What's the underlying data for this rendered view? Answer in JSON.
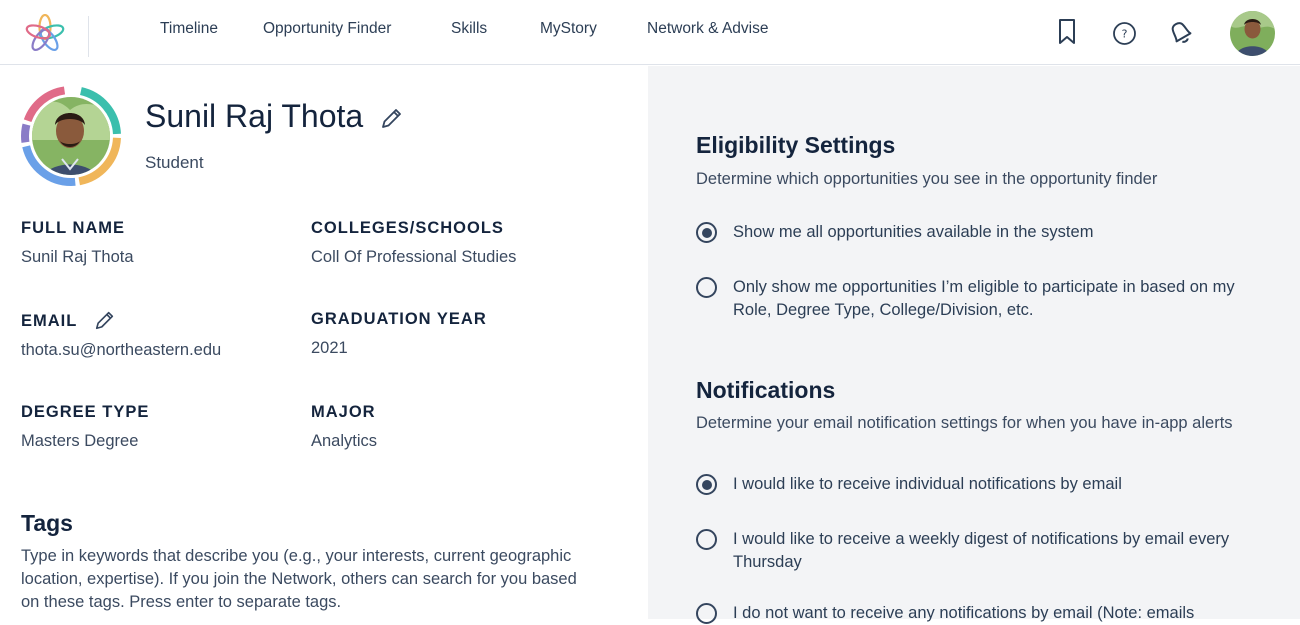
{
  "nav": {
    "links": [
      "Timeline",
      "Opportunity Finder",
      "Skills",
      "MyStory",
      "Network & Advise"
    ],
    "icons": [
      "bookmark-icon",
      "help-icon",
      "bell-icon"
    ]
  },
  "profile": {
    "name": "Sunil Raj Thota",
    "role": "Student",
    "fields": {
      "full_name": {
        "label": "FULL NAME",
        "value": "Sunil Raj Thota"
      },
      "colleges": {
        "label": "COLLEGES/SCHOOLS",
        "value": "Coll Of Professional Studies"
      },
      "email": {
        "label": "EMAIL",
        "value": "thota.su@northeastern.edu"
      },
      "graduation_year": {
        "label": "GRADUATION YEAR",
        "value": "2021"
      },
      "degree_type": {
        "label": "DEGREE TYPE",
        "value": "Masters Degree"
      },
      "major": {
        "label": "MAJOR",
        "value": "Analytics"
      }
    },
    "tags": {
      "title": "Tags",
      "description": "Type in keywords that describe you (e.g., your interests, current geographic location, expertise). If you join the Network, others can search for you based on these tags. Press enter to separate tags."
    }
  },
  "eligibility": {
    "title": "Eligibility Settings",
    "description": "Determine which opportunities you see in the opportunity finder",
    "options": [
      {
        "label": "Show me all opportunities available in the system",
        "checked": true
      },
      {
        "label": "Only show me opportunities I’m eligible to participate in based on my Role, Degree Type, College/Division, etc.",
        "checked": false
      }
    ]
  },
  "notifications": {
    "title": "Notifications",
    "description": "Determine your email notification settings for when you have in-app alerts",
    "options": [
      {
        "label": "I would like to receive individual notifications by email",
        "checked": true
      },
      {
        "label": "I would like to receive a weekly digest of notifications by email every Thursday",
        "checked": false
      },
      {
        "label": "I do not want to receive any notifications by email (Note: emails",
        "checked": false
      }
    ]
  },
  "colors": {
    "primary_text": "#14243d",
    "radio": "#34455e",
    "right_panel_bg": "#f3f4f6",
    "ring_teal": "#3bbfad",
    "ring_orange": "#f0b65a",
    "ring_blue": "#6aa0e8",
    "ring_pink": "#e06b88",
    "ring_purple": "#8a7cc7"
  }
}
